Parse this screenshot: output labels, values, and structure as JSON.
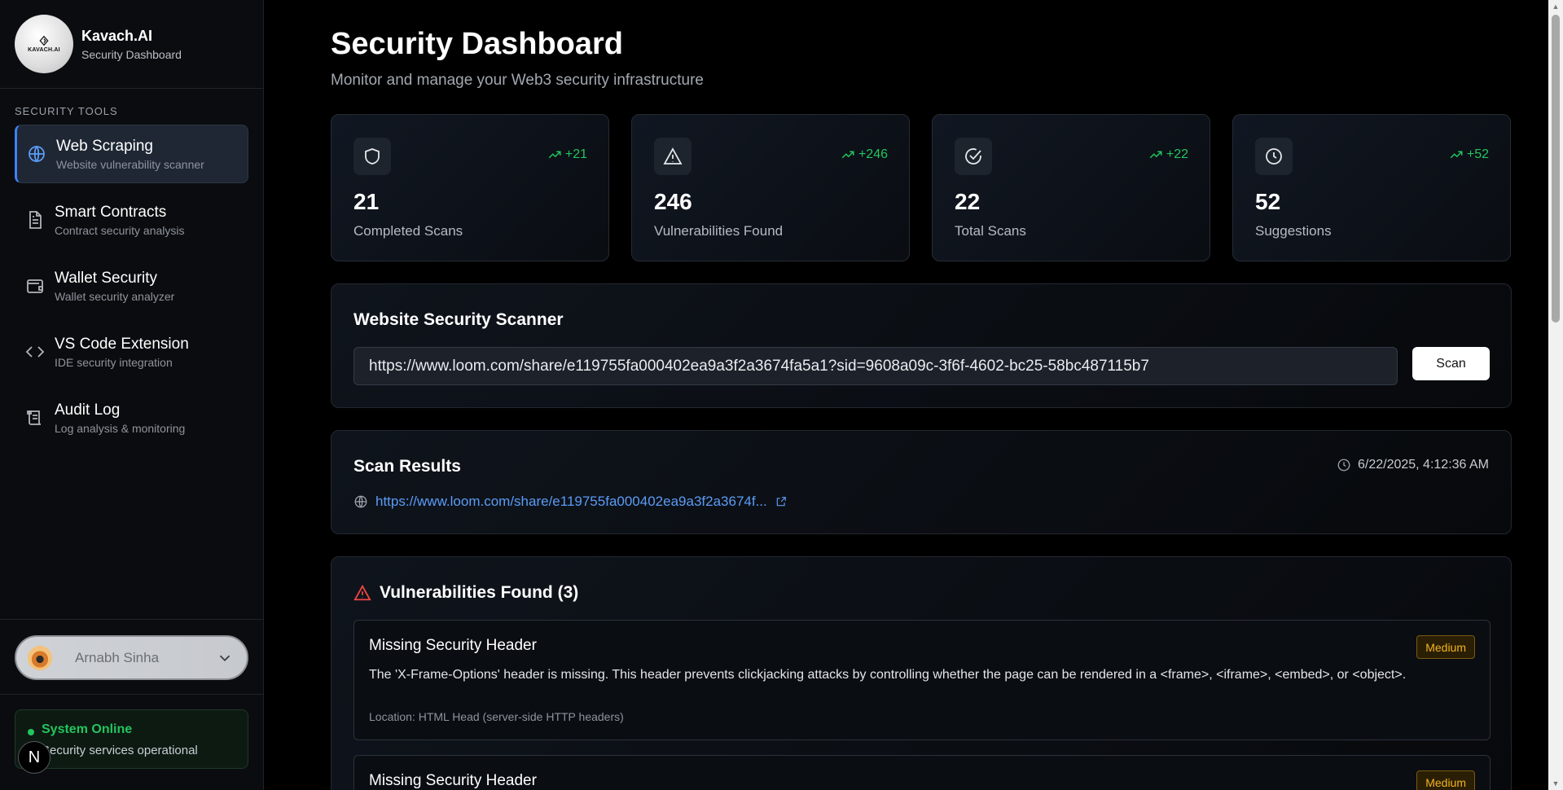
{
  "brand": {
    "name": "Kavach.AI",
    "subtitle": "Security Dashboard",
    "logo_text": "KAVACH.AI"
  },
  "sidebar": {
    "section_label": "SECURITY TOOLS",
    "items": [
      {
        "title": "Web Scraping",
        "desc": "Website vulnerability scanner",
        "icon": "globe-icon",
        "active": true
      },
      {
        "title": "Smart Contracts",
        "desc": "Contract security analysis",
        "icon": "document-icon",
        "active": false
      },
      {
        "title": "Wallet Security",
        "desc": "Wallet security analyzer",
        "icon": "wallet-icon",
        "active": false
      },
      {
        "title": "VS Code Extension",
        "desc": "IDE security integration",
        "icon": "code-icon",
        "active": false
      },
      {
        "title": "Audit Log",
        "desc": "Log analysis & monitoring",
        "icon": "scroll-icon",
        "active": false
      }
    ],
    "user": {
      "name": "Arnabh Sinha"
    },
    "status": {
      "title": "System Online",
      "subtitle": "Security services operational",
      "color": "#22c55e"
    },
    "n_badge": "N"
  },
  "header": {
    "title": "Security Dashboard",
    "subtitle": "Monitor and manage your Web3 security infrastructure"
  },
  "stats": [
    {
      "value": "21",
      "label": "Completed Scans",
      "trend": "+21",
      "icon": "shield-icon"
    },
    {
      "value": "246",
      "label": "Vulnerabilities Found",
      "trend": "+246",
      "icon": "alert-triangle-icon"
    },
    {
      "value": "22",
      "label": "Total Scans",
      "trend": "+22",
      "icon": "check-circle-icon"
    },
    {
      "value": "52",
      "label": "Suggestions",
      "trend": "+52",
      "icon": "clock-icon"
    }
  ],
  "scanner": {
    "title": "Website Security Scanner",
    "url_value": "https://www.loom.com/share/e119755fa000402ea9a3f2a3674fa5a1?sid=9608a09c-3f6f-4602-bc25-58bc487115b7",
    "button_label": "Scan"
  },
  "results": {
    "title": "Scan Results",
    "timestamp": "6/22/2025, 4:12:36 AM",
    "link_text": "https://www.loom.com/share/e119755fa000402ea9a3f2a3674f..."
  },
  "vulnerabilities": {
    "title": "Vulnerabilities Found (3)",
    "items": [
      {
        "name": "Missing Security Header",
        "severity": "Medium",
        "description": "The 'X-Frame-Options' header is missing. This header prevents clickjacking attacks by controlling whether the page can be rendered in a <frame>, <iframe>, <embed>, or <object>.",
        "location": "Location: HTML Head (server-side HTTP headers)"
      },
      {
        "name": "Missing Security Header",
        "severity": "Medium"
      }
    ]
  },
  "colors": {
    "accent_blue": "#3b82f6",
    "trend_green": "#22c55e",
    "severity_medium": "#f5b31f",
    "alert_red": "#ef4444"
  }
}
